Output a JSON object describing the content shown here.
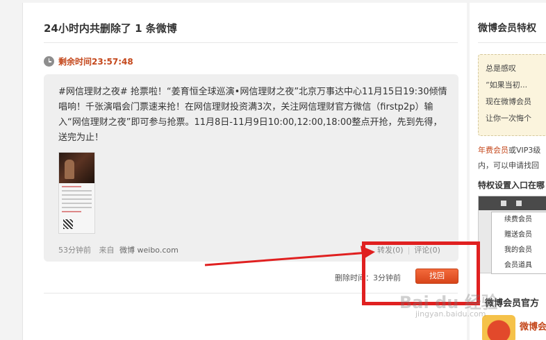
{
  "main": {
    "title": "24小时内共删除了 1 条微博",
    "countdown": "剩余时间23:57:48",
    "post": {
      "text": "#网信理财之夜# 抢票啦！“姜育恒全球巡演•网信理财之夜”北京万事达中心11月15日19:30倾情唱响！千张演唱会门票速来抢！在网信理财投资满3次，关注网信理财官方微信（firstp2p）输入“网信理财之夜”即可参与抢票。11月8日-11月9日10:00,12:00,18:00整点开抢，先到先得，送完为止！",
      "time_ago": "53分钟前",
      "from_label": "来自",
      "source": "微博 weibo.com",
      "repost": "转发(0)",
      "comment": "评论(0)"
    },
    "deleted_time": "删除时间：3分钟前",
    "restore_button": "找回"
  },
  "sidebar": {
    "title": "微博会员特权",
    "note_lines": [
      "总是感叹",
      "“如果当初...",
      "现在微博会员",
      "让你一次悔个"
    ],
    "desc_highlight": "年费会员",
    "desc_rest": "或VIP3级",
    "desc_line2": "内，可以申请找回",
    "subtitle": "特权设置入口在哪",
    "menu_items": [
      "续费会员",
      "赠送会员",
      "我的会员",
      "会员道具"
    ],
    "title2": "微博会员官方",
    "brand": "微博会"
  },
  "watermark": {
    "main": "Bai du 经验",
    "sub": "jingyan.baidu.com"
  },
  "colors": {
    "accent": "#c4471b",
    "button": "#e8512a",
    "annotation": "#e02020",
    "card_bg": "#efefef"
  }
}
